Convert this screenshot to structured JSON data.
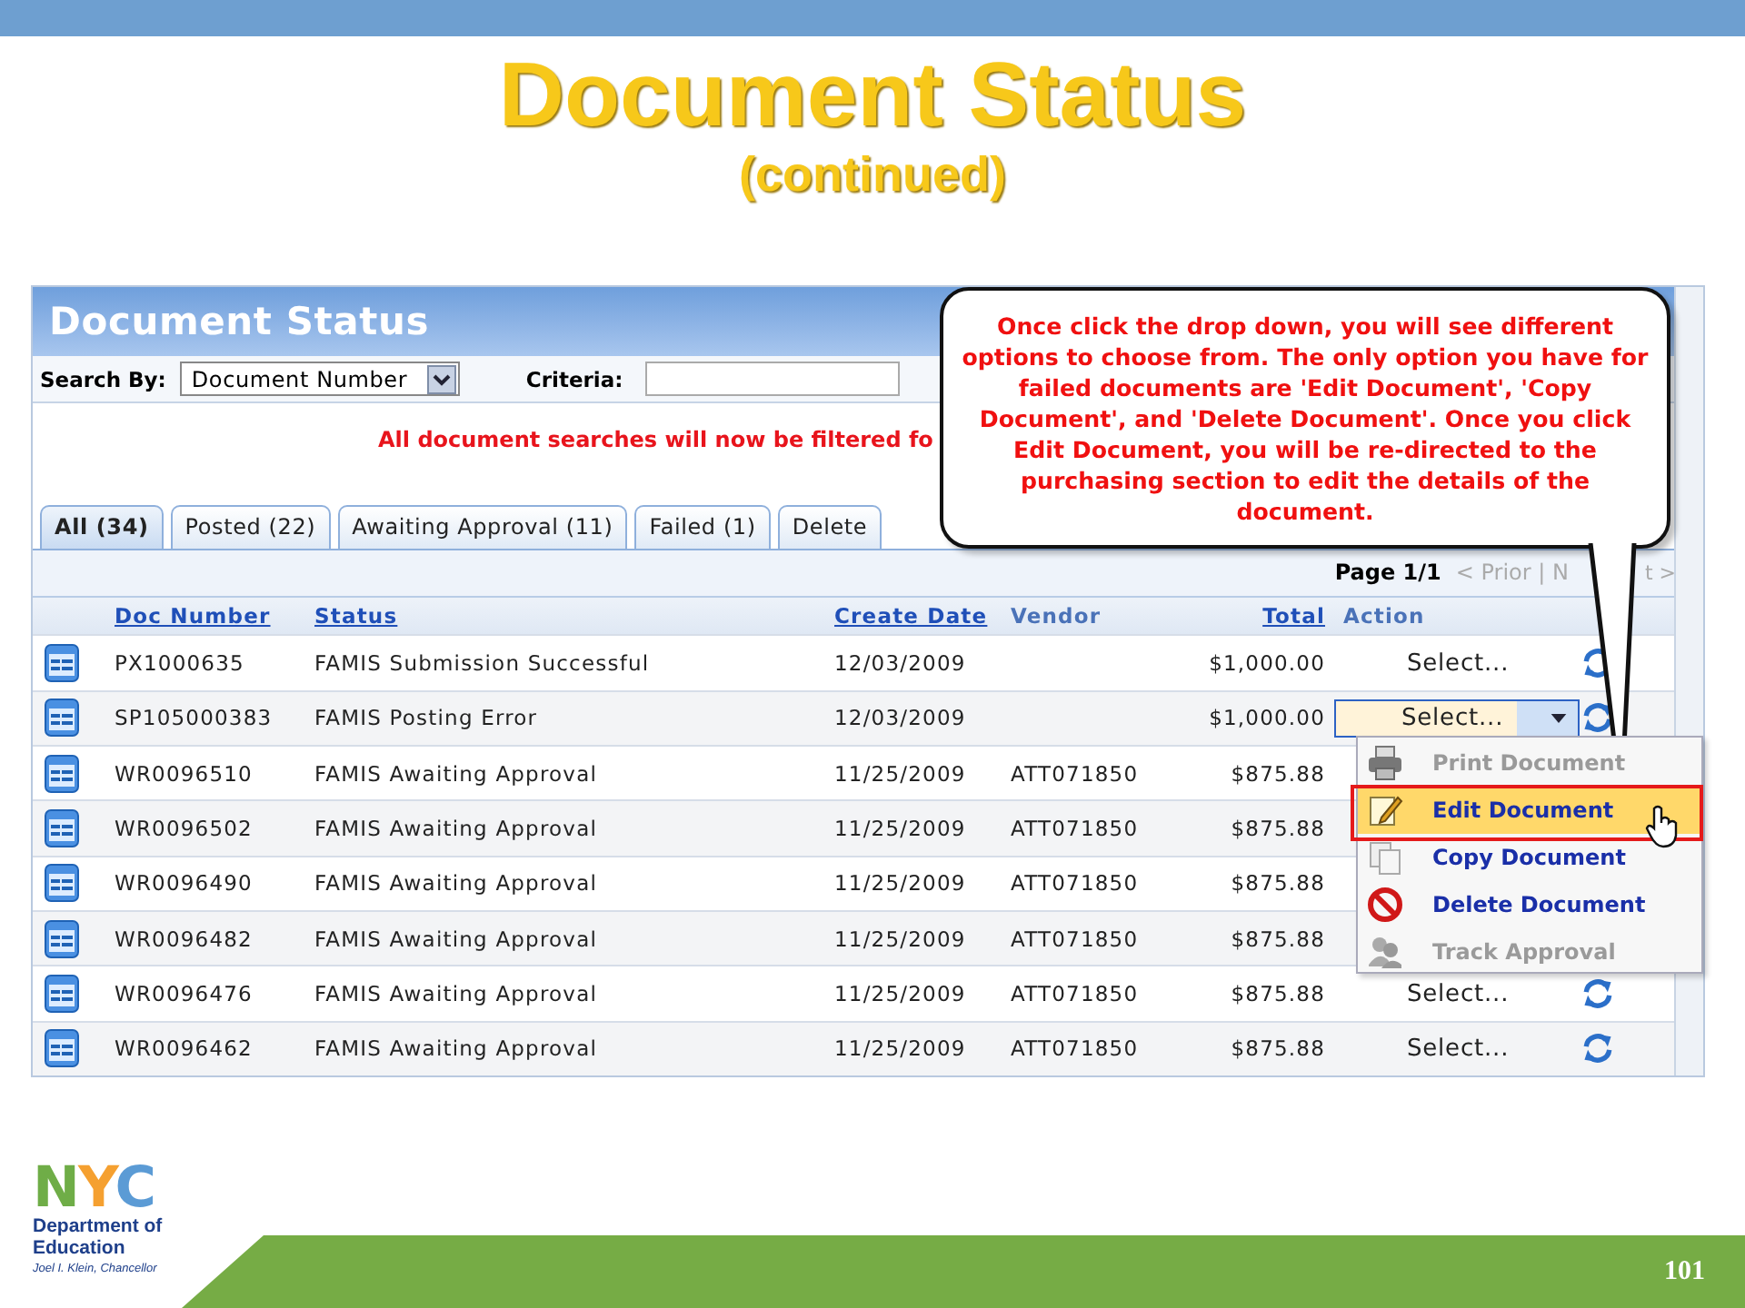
{
  "slide": {
    "title": "Document Status",
    "subtitle": "(continued)",
    "number": "101"
  },
  "logo": {
    "mark": "NYC",
    "name": "Department of Education",
    "tagline": "Joel I. Klein, Chancellor"
  },
  "app": {
    "title": "Document Status",
    "search": {
      "label": "Search By:",
      "value": "Document Number",
      "criteria_label": "Criteria:"
    },
    "notice": "All document searches will now be filtered fo",
    "tabs": [
      {
        "label": "All (34)",
        "selected": true
      },
      {
        "label": "Posted (22)",
        "selected": false
      },
      {
        "label": "Awaiting Approval (11)",
        "selected": false
      },
      {
        "label": "Failed (1)",
        "selected": false
      },
      {
        "label": "Delete",
        "selected": false
      }
    ],
    "pager": {
      "page": "Page 1/1",
      "prior": "< Prior | N",
      "next": "t >"
    },
    "columns": [
      {
        "label": "Doc Number",
        "sortable": true
      },
      {
        "label": "Status",
        "sortable": true
      },
      {
        "label": "Create Date",
        "sortable": true
      },
      {
        "label": "Vendor",
        "sortable": false
      },
      {
        "label": "Total",
        "sortable": true
      },
      {
        "label": "Action",
        "sortable": false
      }
    ],
    "rows": [
      {
        "doc": "PX1000635",
        "status": "FAMIS Submission Successful",
        "date": "12/03/2009",
        "total": "$1,000.00",
        "action": "Select...",
        "focused": false
      },
      {
        "doc": "SP105000383",
        "status": "FAMIS Posting Error",
        "date": "12/03/2009",
        "total": "$1,000.00",
        "action": "Select...",
        "focused": true
      },
      {
        "doc": "WR0096510",
        "status": "FAMIS Awaiting Approval",
        "date": "11/25/2009",
        "vendor": "ATT071850",
        "total": "$875.88"
      },
      {
        "doc": "WR0096502",
        "status": "FAMIS Awaiting Approval",
        "date": "11/25/2009",
        "vendor": "ATT071850",
        "total": "$875.88"
      },
      {
        "doc": "WR0096490",
        "status": "FAMIS Awaiting Approval",
        "date": "11/25/2009",
        "vendor": "ATT071850",
        "total": "$875.88"
      },
      {
        "doc": "WR0096482",
        "status": "FAMIS Awaiting Approval",
        "date": "11/25/2009",
        "vendor": "ATT071850",
        "total": "$875.88"
      },
      {
        "doc": "WR0096476",
        "status": "FAMIS Awaiting Approval",
        "date": "11/25/2009",
        "vendor": "ATT071850",
        "total": "$875.88",
        "action": "Select...",
        "focused": false
      },
      {
        "doc": "WR0096462",
        "status": "FAMIS Awaiting Approval",
        "date": "11/25/2009",
        "vendor": "ATT071850",
        "total": "$875.88",
        "action": "Select...",
        "focused": false
      }
    ],
    "menu": [
      {
        "kind": "print",
        "label": "Print Document",
        "disabled": true,
        "selected": false
      },
      {
        "kind": "edit",
        "label": "Edit Document",
        "disabled": false,
        "selected": true
      },
      {
        "kind": "copy",
        "label": "Copy Document",
        "disabled": false,
        "selected": false
      },
      {
        "kind": "delete",
        "label": "Delete Document",
        "disabled": false,
        "selected": false
      },
      {
        "kind": "track",
        "label": "Track Approval",
        "disabled": true,
        "selected": false
      }
    ]
  },
  "callout": {
    "text": "Once click the drop down, you will see different options to choose from.  The only option you have for failed documents are 'Edit Document', 'Copy Document', and 'Delete Document'.  Once you click Edit Document, you will be re-directed to the purchasing section to edit the details of the document."
  }
}
